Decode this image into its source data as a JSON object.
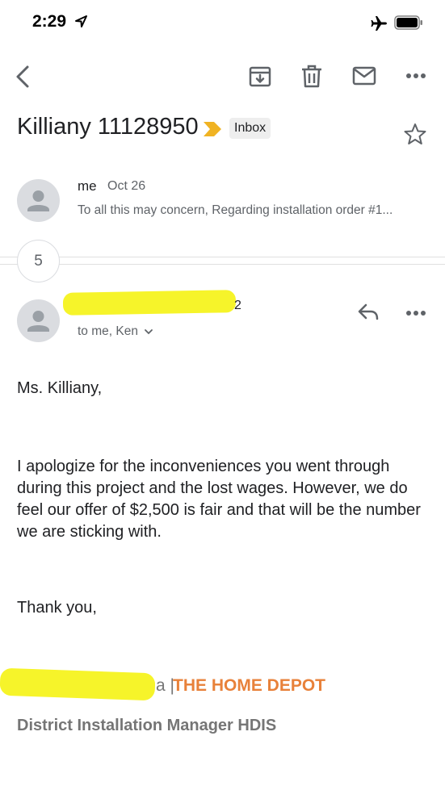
{
  "status_bar": {
    "time": "2:29"
  },
  "email": {
    "subject": "Killiany 11128950",
    "label": "Inbox",
    "accent_color": "#f0b323"
  },
  "thread": {
    "count": "5",
    "first_message": {
      "sender": "me",
      "date": "Oct 26",
      "snippet": "To all this may concern, Regarding installation order #1..."
    },
    "last_message": {
      "sender": "2",
      "recipients": "to me, Ken",
      "greeting": "Ms. Killiany,",
      "paragraph": "I apologize for the inconveniences you went through during this project and the lost wages. However, we do feel our offer of $2,500 is fair and that will be the number we are sticking with.",
      "closing": "Thank you,",
      "signature_separator": "a |",
      "signature_company": "THE HOME DEPOT",
      "signature_title": "District Installation Manager HDIS",
      "signature_company_color": "#e8813a",
      "redaction_color": "#f6f42a"
    }
  },
  "icons": [
    "location-arrow-icon",
    "airplane-icon",
    "battery-icon",
    "back-arrow-icon",
    "archive-icon",
    "trash-icon",
    "mail-icon",
    "more-icon",
    "label-arrow-icon",
    "star-icon",
    "avatar-icon",
    "reply-icon",
    "more-icon",
    "chevron-down-icon"
  ]
}
